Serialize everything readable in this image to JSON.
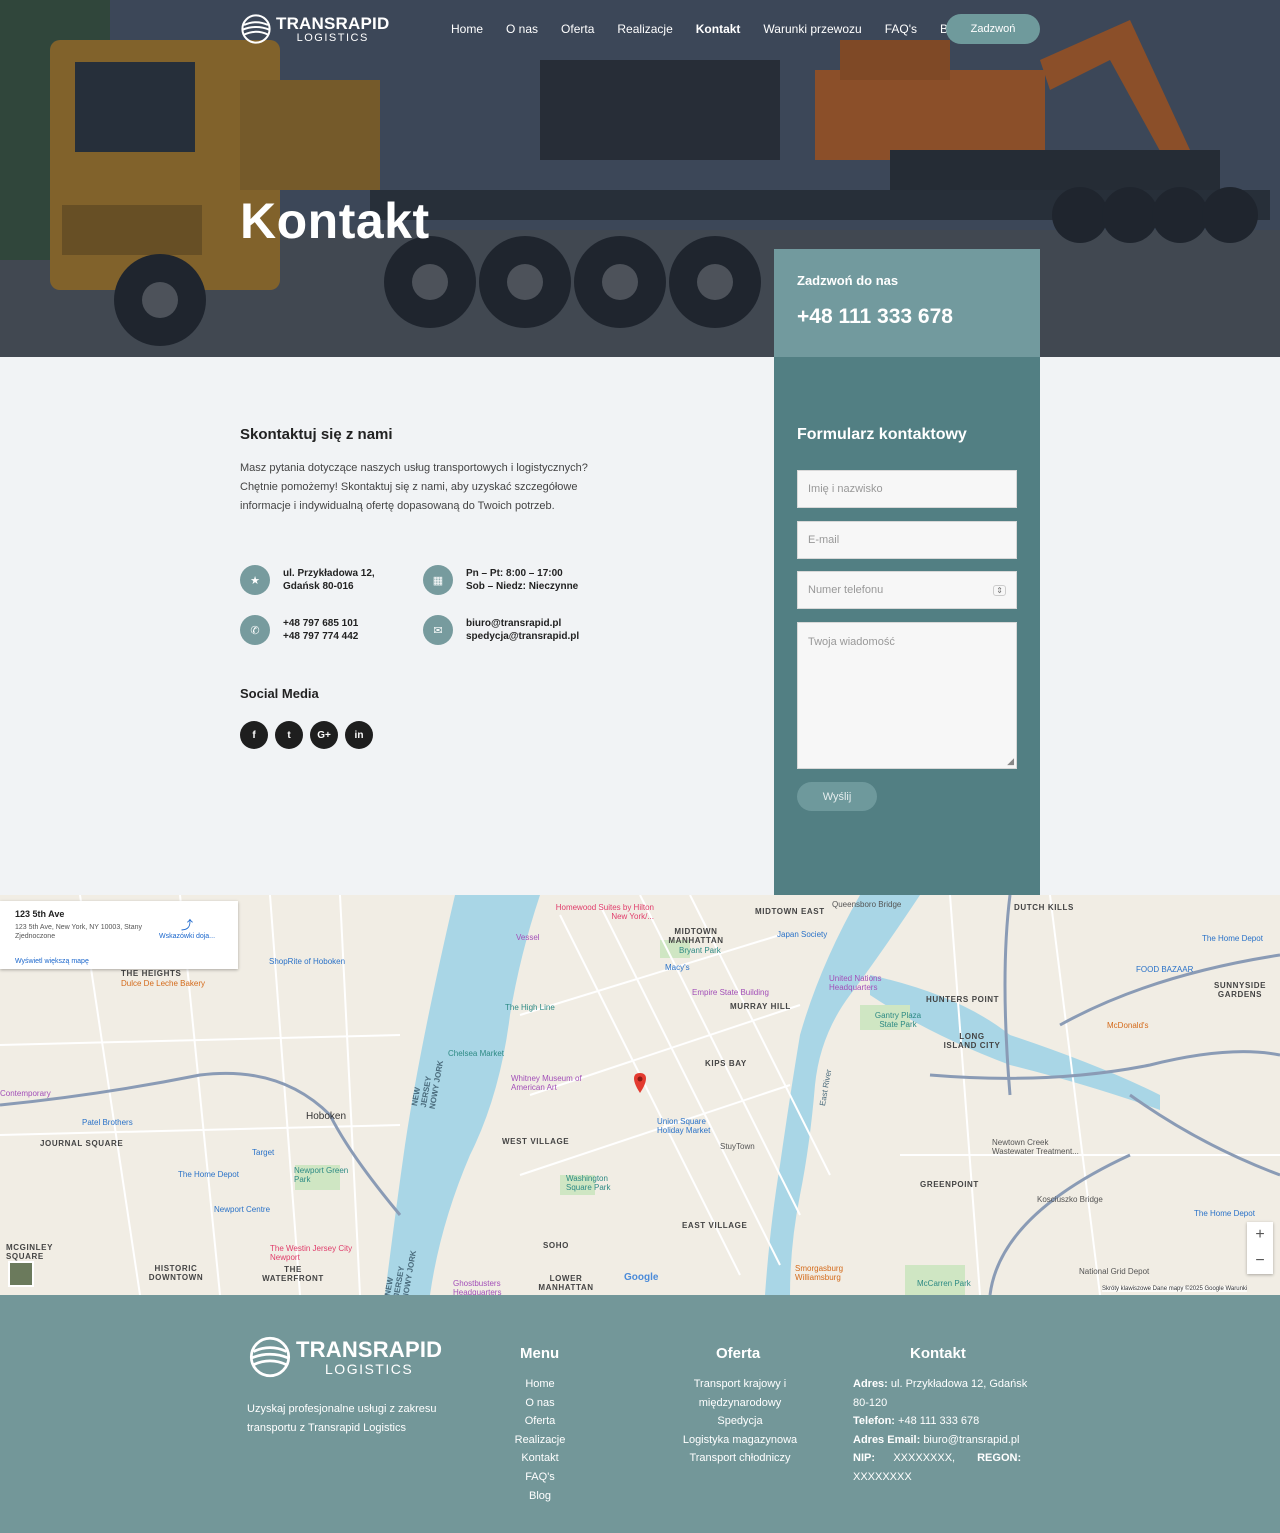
{
  "brand": {
    "name": "TRANSRAPID",
    "sub": "LOGISTICS"
  },
  "nav": {
    "items": [
      "Home",
      "O nas",
      "Oferta",
      "Realizacje",
      "Kontakt",
      "Warunki przewozu",
      "FAQ's",
      "Blog"
    ],
    "active": "Kontakt",
    "cta": "Zadzwoń"
  },
  "hero": {
    "title": "Kontakt"
  },
  "callbox": {
    "label": "Zadzwoń do nas",
    "phone": "+48 111 333 678"
  },
  "form": {
    "title": "Formularz kontaktowy",
    "name_placeholder": "Imię i nazwisko",
    "email_placeholder": "E-mail",
    "phone_placeholder": "Numer telefonu",
    "message_placeholder": "Twoja wiadomość",
    "submit": "Wyślij"
  },
  "contact": {
    "title": "Skontaktuj się z nami",
    "description": "Masz pytania dotyczące naszych usług transportowych i logistycznych? Chętnie pomożemy! Skontaktuj się z nami, aby uzyskać szczegółowe informacje i indywidualną ofertę dopasowaną do Twoich potrzeb.",
    "address": [
      "ul. Przykładowa 12,",
      "Gdańsk 80-016"
    ],
    "hours": [
      "Pn – Pt: 8:00 – 17:00",
      "Sob – Niedz: Nieczynne"
    ],
    "phones": [
      "+48 797 685 101",
      "+48 797 774 442"
    ],
    "emails": [
      "biuro@transrapid.pl",
      "spedycja@transrapid.pl"
    ]
  },
  "social": {
    "title": "Social Media",
    "items": [
      "f",
      "t",
      "G+",
      "in"
    ]
  },
  "map": {
    "place_name": "123 5th Ave",
    "place_address": "123 5th Ave, New York, NY 10003, Stany Zjednoczone",
    "larger_map": "Wyświetl większą mapę",
    "directions": "Wskazówki doja...",
    "footer": "Skróty klawiszowe   Dane mapy ©2025 Google   Warunki",
    "google": "Google",
    "labels": {
      "midtown": "MIDTOWN MANHATTAN",
      "murray": "MURRAY HILL",
      "kips": "KIPS BAY",
      "westvillage": "WEST VILLAGE",
      "eastvillage": "EAST VILLAGE",
      "soho": "SOHO",
      "lowerman": "LOWER MANHATTAN",
      "greenpoint": "GREENPOINT",
      "hunters": "HUNTERS POINT",
      "lic": "LONG ISLAND CITY",
      "dutch": "DUTCH KILLS",
      "sunnyside": "SUNNYSIDE GARDENS",
      "heights": "THE HEIGHTS",
      "journal": "JOURNAL SQUARE",
      "historic": "HISTORIC DOWNTOWN",
      "waterfront": "THE WATERFRONT",
      "hoboken": "Hoboken",
      "mcginley": "MCGINLEY SQUARE",
      "midtowneast": "MIDTOWN EAST",
      "empire": "Empire State Building",
      "macys": "Macy's",
      "bryant": "Bryant Park",
      "highline": "The High Line",
      "chelsea": "Chelsea Market",
      "whitney": "Whitney Museum of American Art",
      "union": "Union Square Holiday Market",
      "washington": "Washington Square Park",
      "stuy": "StuyTown",
      "un": "United Nations Headquarters",
      "japan": "Japan Society",
      "gantry": "Gantry Plaza State Park",
      "homewood": "Homewood Suites by Hilton New York/...",
      "vessel": "Vessel",
      "newport": "Newport Green Park",
      "newportcentre": "Newport Centre",
      "westin": "The Westin Jersey City Newport",
      "target": "Target",
      "homedepot1": "The Home Depot",
      "homedepot2": "The Home Depot",
      "homedepot3": "The Home Depot",
      "shoprite": "ShopRite of Hoboken",
      "dulce": "Dulce De Leche Bakery",
      "patel": "Patel Brothers",
      "contemporary": "Contemporary",
      "foodbazaar": "FOOD BAZAAR",
      "mcdonalds": "McDonald's",
      "newtown": "Newtown Creek Wastewater Treatment...",
      "kosciuszko": "Kosciuszko Bridge",
      "smorgasburg": "Smorgasburg Williamsburg",
      "mccarren": "McCarren Park",
      "natgrid": "National Grid Depot",
      "ghost": "Ghostbusters Headquarters",
      "queensboro": "Queensboro Bridge",
      "njny1": "NEW JERSEY NOWY JORK",
      "njny2": "NEW JERSEY NOWY JORK",
      "eastriver": "East River"
    }
  },
  "footer": {
    "tagline": "Uzyskaj profesjonalne usługi z zakresu transportu z Transrapid Logistics",
    "menu_title": "Menu",
    "menu": [
      "Home",
      "O nas",
      "Oferta",
      "Realizacje",
      "Kontakt",
      "FAQ's",
      "Blog"
    ],
    "offer_title": "Oferta",
    "offer": [
      "Transport krajowy i",
      "międzynarodowy",
      "Spedycja",
      "Logistyka magazynowa",
      "Transport chłodniczy"
    ],
    "contact_title": "Kontakt",
    "addr_label": "Adres:",
    "addr": "ul. Przykładowa 12, Gdańsk 80-120",
    "tel_label": "Telefon:",
    "tel": "+48 111 333 678",
    "email_label": "Adres Email:",
    "email": "biuro@transrapid.pl",
    "nip_label": "NIP:",
    "nip": "XXXXXXXX,",
    "regon_label": "REGON:",
    "regon": "XXXXXXXX"
  },
  "colors": {
    "accent": "#527f83",
    "accent_light": "#729a9e",
    "footer": "#739799",
    "dark": "#1e1e1e"
  }
}
